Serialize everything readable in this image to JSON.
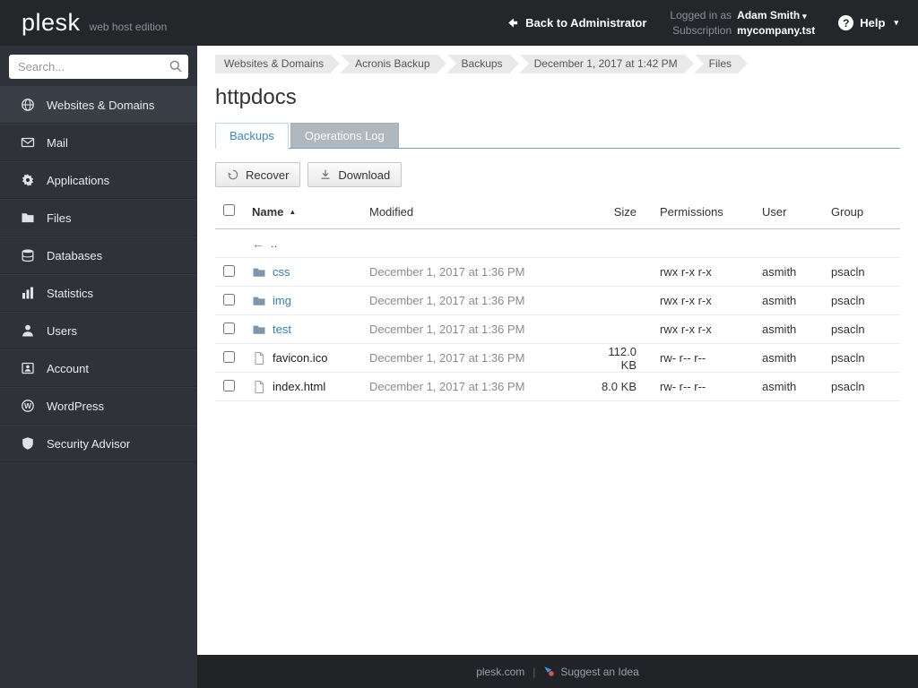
{
  "topbar": {
    "logo": "plesk",
    "edition": "web host edition",
    "back_label": "Back to Administrator",
    "logged_in_label": "Logged in as",
    "user_name": "Adam Smith",
    "subscription_label": "Subscription",
    "subscription_value": "mycompany.tst",
    "help_label": "Help"
  },
  "sidebar": {
    "search_placeholder": "Search...",
    "items": [
      {
        "label": "Websites & Domains",
        "icon": "globe-icon",
        "active": true
      },
      {
        "label": "Mail",
        "icon": "mail-icon",
        "active": false
      },
      {
        "label": "Applications",
        "icon": "gear-icon",
        "active": false
      },
      {
        "label": "Files",
        "icon": "folder-icon",
        "active": false
      },
      {
        "label": "Databases",
        "icon": "database-icon",
        "active": false
      },
      {
        "label": "Statistics",
        "icon": "bar-chart-icon",
        "active": false
      },
      {
        "label": "Users",
        "icon": "user-icon",
        "active": false
      },
      {
        "label": "Account",
        "icon": "account-badge-icon",
        "active": false
      },
      {
        "label": "WordPress",
        "icon": "wordpress-icon",
        "active": false
      },
      {
        "label": "Security Advisor",
        "icon": "shield-icon",
        "active": false
      }
    ]
  },
  "main": {
    "breadcrumb": [
      "Websites & Domains",
      "Acronis Backup",
      "Backups",
      "December 1, 2017 at 1:42 PM",
      "Files"
    ],
    "title": "httpdocs",
    "tabs": [
      {
        "label": "Backups",
        "active": true
      },
      {
        "label": "Operations Log",
        "active": false
      }
    ],
    "toolbar": {
      "recover_label": "Recover",
      "download_label": "Download"
    },
    "table": {
      "headers": {
        "name": "Name",
        "modified": "Modified",
        "size": "Size",
        "permissions": "Permissions",
        "user": "User",
        "group": "Group"
      },
      "parent_row": {
        "label": ".."
      },
      "rows": [
        {
          "name": "css",
          "type": "folder",
          "modified": "December 1, 2017 at 1:36 PM",
          "size": "",
          "permissions": "rwx r-x r-x",
          "user": "asmith",
          "group": "psacln"
        },
        {
          "name": "img",
          "type": "folder",
          "modified": "December 1, 2017 at 1:36 PM",
          "size": "",
          "permissions": "rwx r-x r-x",
          "user": "asmith",
          "group": "psacln"
        },
        {
          "name": "test",
          "type": "folder",
          "modified": "December 1, 2017 at 1:36 PM",
          "size": "",
          "permissions": "rwx r-x r-x",
          "user": "asmith",
          "group": "psacln"
        },
        {
          "name": "favicon.ico",
          "type": "file",
          "modified": "December 1, 2017 at 1:36 PM",
          "size": "112.0 KB",
          "permissions": "rw- r-- r--",
          "user": "asmith",
          "group": "psacln"
        },
        {
          "name": "index.html",
          "type": "file",
          "modified": "December 1, 2017 at 1:36 PM",
          "size": "8.0 KB",
          "permissions": "rw- r-- r--",
          "user": "asmith",
          "group": "psacln"
        }
      ]
    }
  },
  "footer": {
    "site_link": "plesk.com",
    "separator": "|",
    "suggest_link": "Suggest an Idea"
  },
  "icons": {
    "caret_down": "▾",
    "sort_asc": "▲",
    "up_arrow": "←",
    "help_glyph": "?"
  },
  "colors": {
    "topbar_bg": "#25262a",
    "sidebar_bg": "#2f3238",
    "accent_blue": "#3a87c8",
    "link_blue": "#2e81bd",
    "tab_inactive_bg": "#b0b7bd",
    "footer_bg": "#222327"
  }
}
